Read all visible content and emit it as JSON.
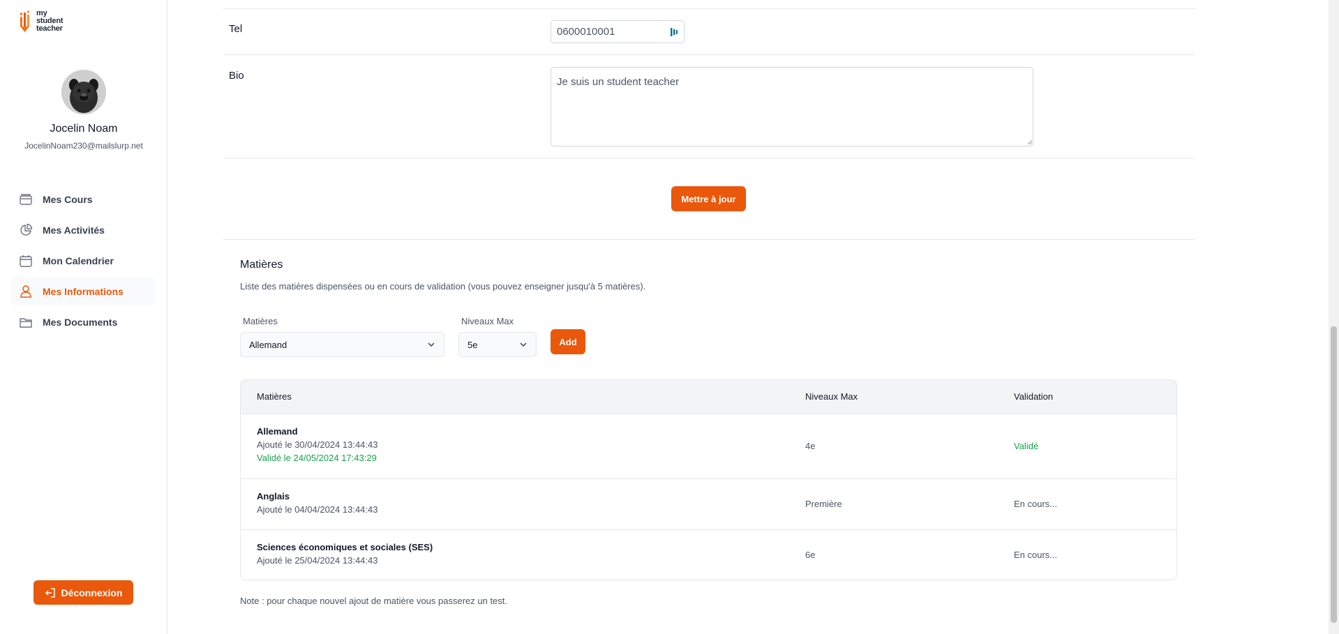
{
  "sidebar": {
    "logo_lines": [
      "my",
      "student",
      "teacher"
    ],
    "user": {
      "name": "Jocelin Noam",
      "email": "JocelinNoam230@mailslurp.net"
    },
    "items": [
      {
        "label": "Mes Cours",
        "icon": "book-icon",
        "active": false
      },
      {
        "label": "Mes Activités",
        "icon": "pie-chart-icon",
        "active": false
      },
      {
        "label": "Mon Calendrier",
        "icon": "calendar-icon",
        "active": false
      },
      {
        "label": "Mes Informations",
        "icon": "user-icon",
        "active": true
      },
      {
        "label": "Mes Documents",
        "icon": "folder-icon",
        "active": false
      }
    ],
    "logout_label": "Déconnexion"
  },
  "form": {
    "tel_label": "Tel",
    "tel_value": "0600010001",
    "bio_label": "Bio",
    "bio_value": "Je suis un student teacher",
    "update_label": "Mettre à jour"
  },
  "subjects": {
    "title": "Matières",
    "description": "Liste des matières dispensées ou en cours de validation (vous pouvez enseigner jusqu'à 5 matières).",
    "subject_select_label": "Matières",
    "subject_select_value": "Allemand",
    "level_select_label": "Niveaux Max",
    "level_select_value": "5e",
    "add_label": "Add",
    "table": {
      "headers": [
        "Matières",
        "Niveaux Max",
        "Validation"
      ],
      "rows": [
        {
          "name": "Allemand",
          "added": "Ajouté le 30/04/2024 13:44:43",
          "validated": "Validé le 24/05/2024 17:43:29",
          "level": "4e",
          "status": "Validé",
          "status_type": "ok"
        },
        {
          "name": "Anglais",
          "added": "Ajouté le 04/04/2024 13:44:43",
          "validated": "",
          "level": "Première",
          "status": "En cours...",
          "status_type": "pending"
        },
        {
          "name": "Sciences économiques et sociales (SES)",
          "added": "Ajouté le 25/04/2024 13:44:43",
          "validated": "",
          "level": "6e",
          "status": "En cours...",
          "status_type": "pending"
        }
      ]
    },
    "note": "Note : pour chaque nouvel ajout de matière vous passerez un test."
  },
  "colors": {
    "accent": "#ea580c",
    "success": "#16a34a"
  }
}
